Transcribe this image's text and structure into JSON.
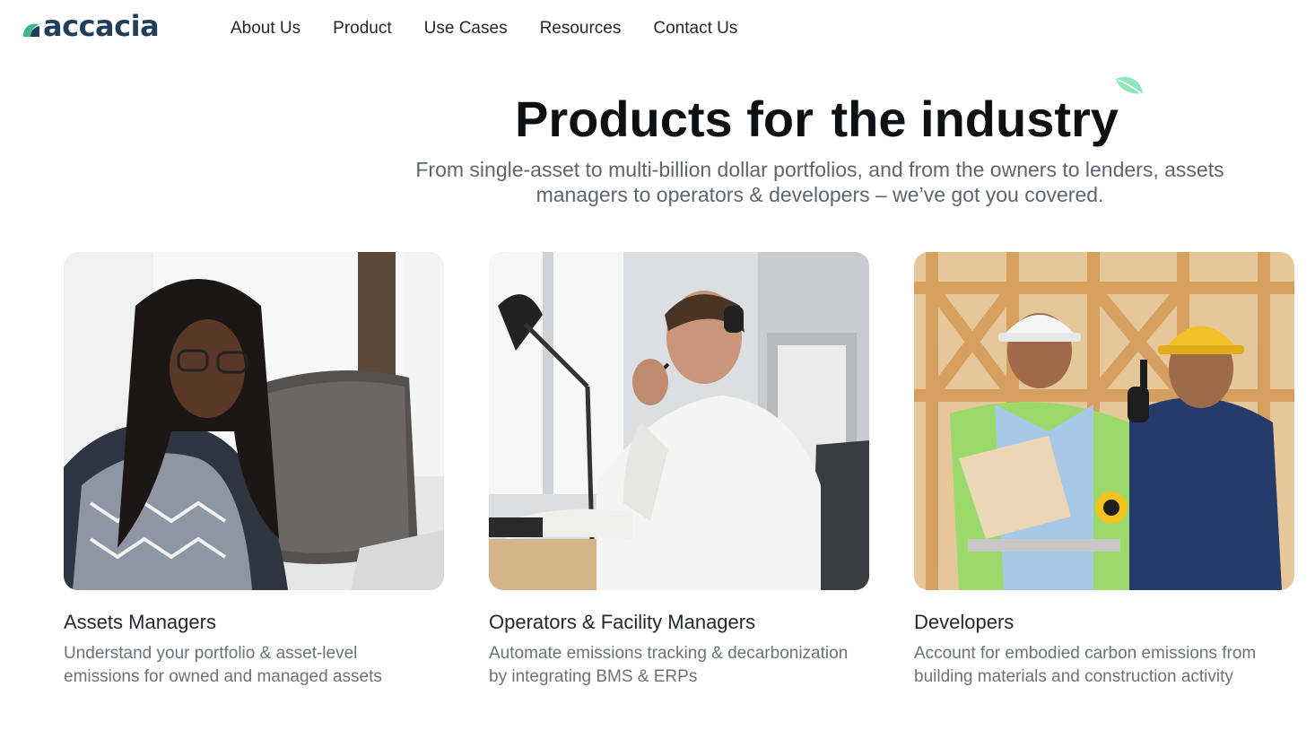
{
  "brand": {
    "name": "accacia",
    "mark_color": "#3fb68b",
    "text_color": "#1f3f5c"
  },
  "nav": {
    "items": [
      {
        "label": "About Us"
      },
      {
        "label": "Product"
      },
      {
        "label": "Use Cases"
      },
      {
        "label": "Resources"
      },
      {
        "label": "Contact Us"
      }
    ]
  },
  "hero": {
    "title_prefix": "Products for ",
    "title_highlight": "the industry",
    "highlight_color": "#d5f8e6",
    "leaf_color": "#8ce7bb",
    "subtitle": "From single-asset to multi-billion dollar portfolios, and from the owners to lenders, assets managers to operators & developers – we’ve got you covered."
  },
  "cards": [
    {
      "title": "Assets Managers",
      "description": "Understand your portfolio & asset-level emissions for owned and managed assets",
      "image": "photo-woman-braids-laptop"
    },
    {
      "title": "Operators & Facility Managers",
      "description": "Automate emissions tracking & decarbonization by integrating BMS & ERPs",
      "image": "photo-man-headset-desk"
    },
    {
      "title": "Developers",
      "description": "Account for embodied carbon emissions from building materials and construction activity",
      "image": "photo-construction-workers-hardhats"
    }
  ]
}
